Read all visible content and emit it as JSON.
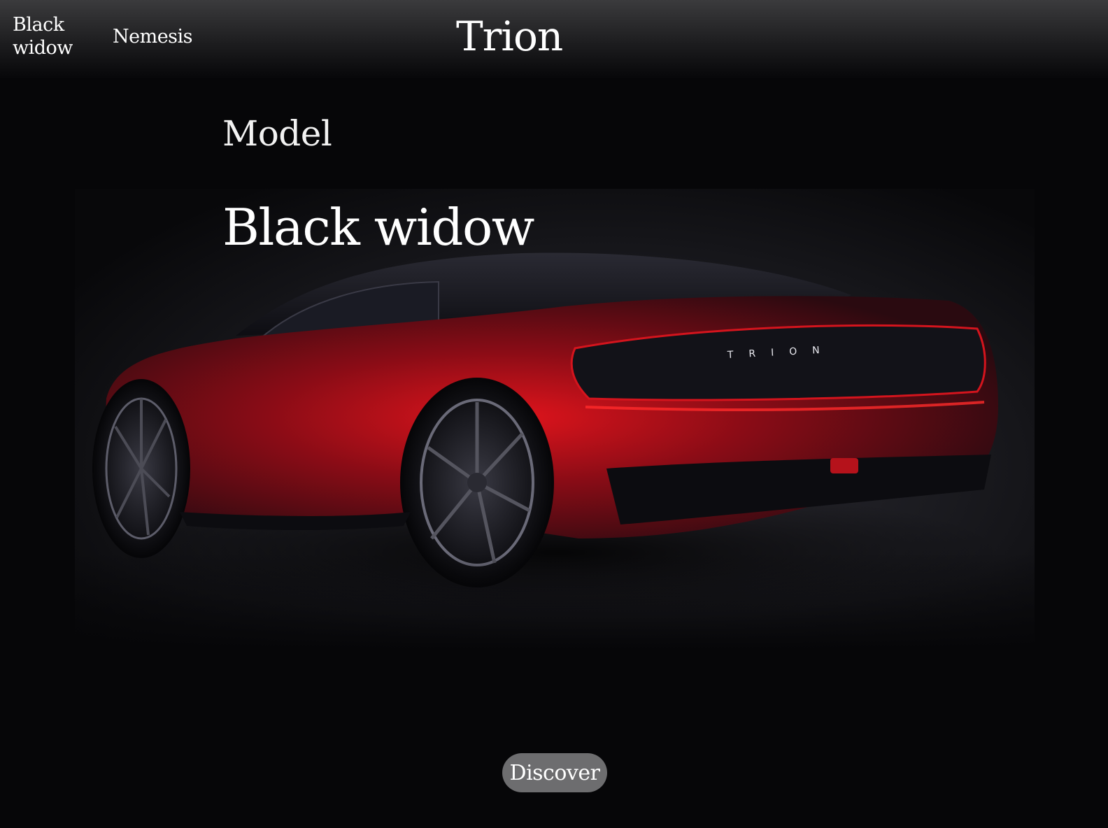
{
  "header": {
    "nav": [
      {
        "label": "Black widow"
      },
      {
        "label": "Nemesis"
      }
    ],
    "brand": "Trion"
  },
  "hero": {
    "section_label": "Model",
    "model_name": "Black widow",
    "image_badge": "TRION",
    "image_description": "rear three-quarter view of a red sports coupe"
  },
  "cta": {
    "discover_label": "Discover"
  },
  "colors": {
    "background": "#060608",
    "header_top": "#3b3b3d",
    "car_red": "#c0121a",
    "button_bg": "#6d6d6f"
  }
}
